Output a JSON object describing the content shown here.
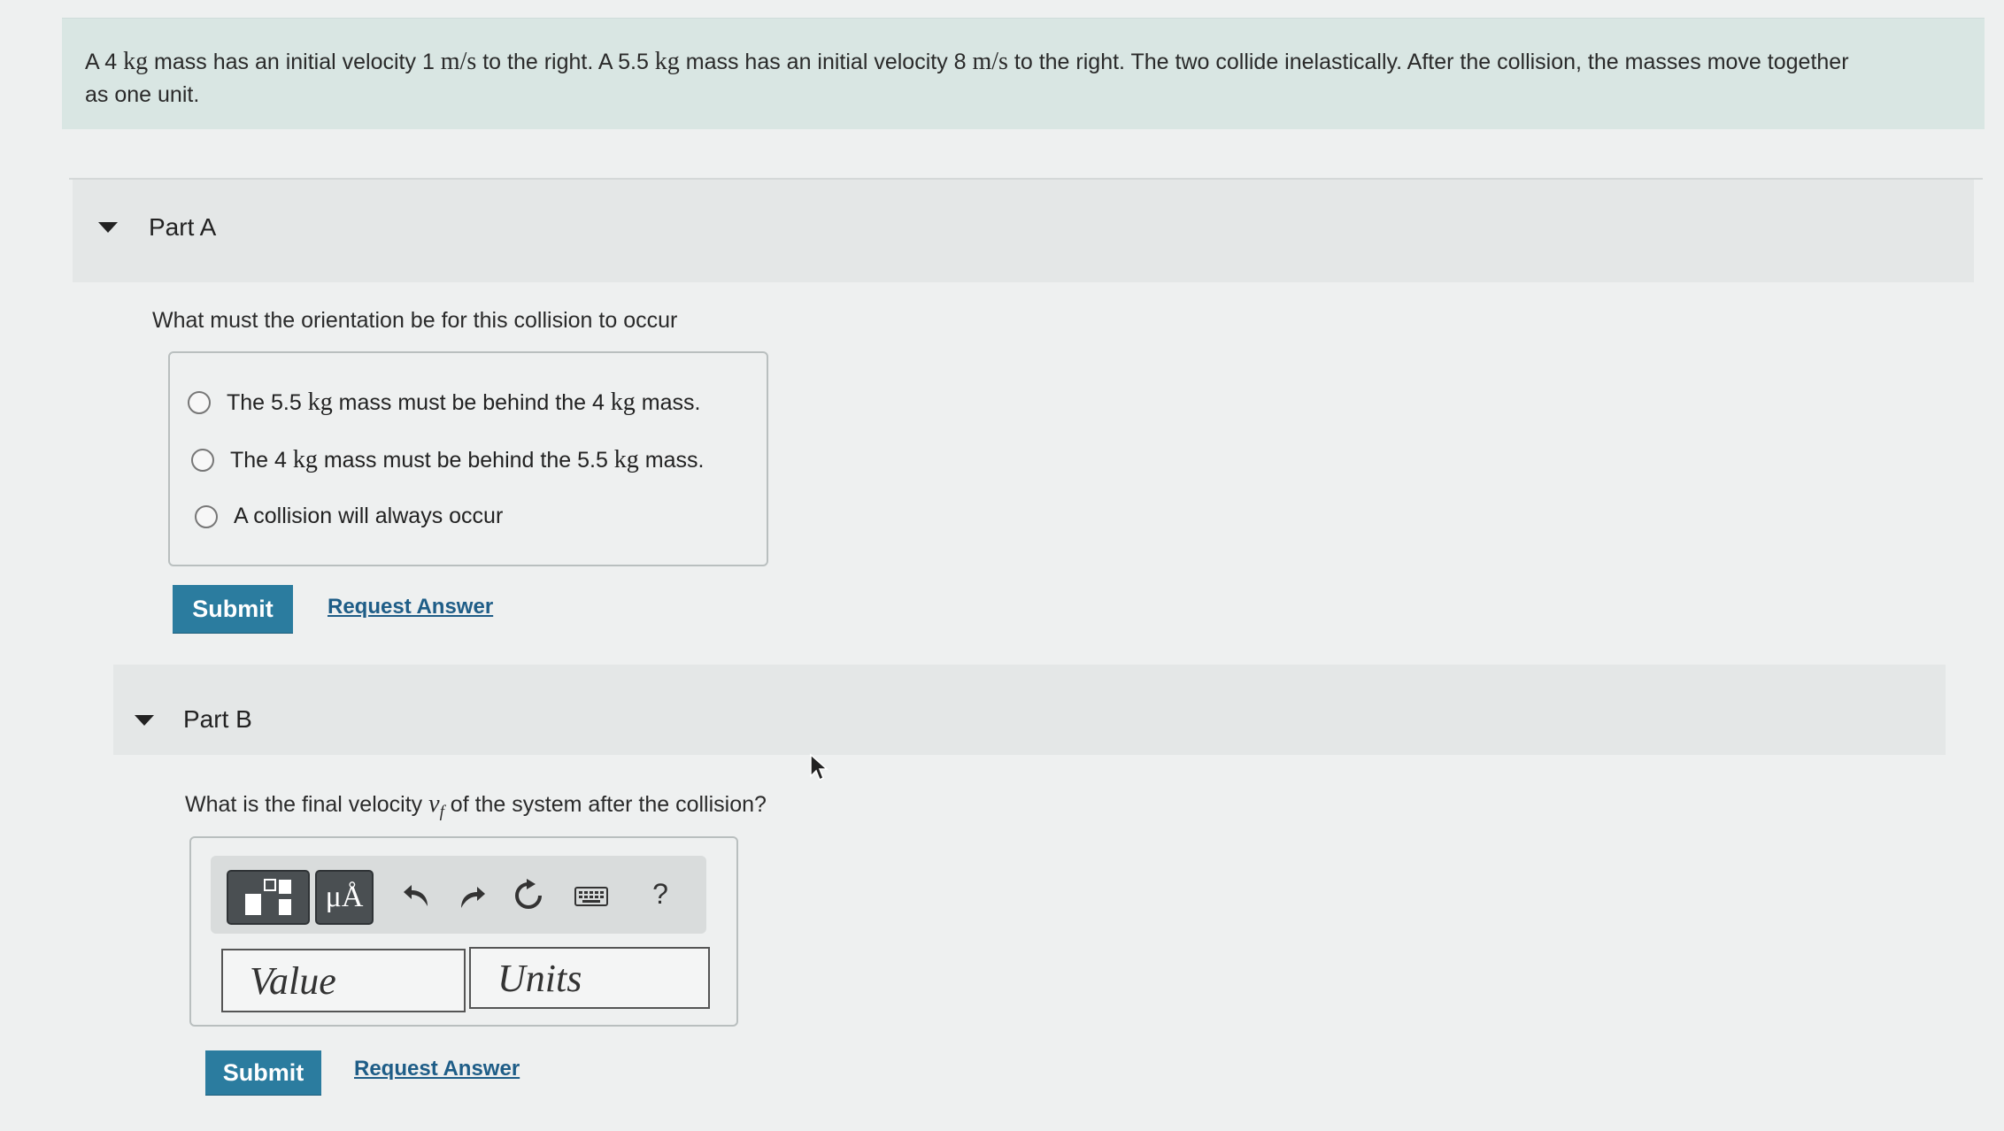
{
  "problem": {
    "seg1": "A 4 ",
    "u_kg1": "kg",
    "seg2": " mass has an initial velocity 1 ",
    "u_ms1": "m/s",
    "seg3": " to the right.  A 5.5 ",
    "u_kg2": "kg",
    "seg4": " mass has an initial velocity 8 ",
    "u_ms2": "m/s",
    "seg5": " to the right.  The two collide inelastically.  After the collision, the masses move together",
    "line2": "as one unit."
  },
  "part_a": {
    "label": "Part A",
    "question": "What must the orientation be for this collision to occur",
    "choices": [
      {
        "pre": "The 5.5 ",
        "unit1": "kg",
        "mid": " mass must be behind the 4 ",
        "unit2": "kg",
        "post": " mass."
      },
      {
        "pre": "The 4 ",
        "unit1": "kg",
        "mid": " mass must be behind the 5.5 ",
        "unit2": "kg",
        "post": " mass."
      },
      {
        "text": "A collision will always occur"
      }
    ],
    "submit_label": "Submit",
    "request_label": "Request Answer"
  },
  "part_b": {
    "label": "Part B",
    "question_pre": "What is the final velocity ",
    "var": "v",
    "sub": "f",
    "question_post": " of the system after the collision?",
    "toolbar": {
      "units_label": "μÅ",
      "help_label": "?"
    },
    "value_placeholder": "Value",
    "units_placeholder": "Units",
    "submit_label": "Submit",
    "request_label": "Request Answer"
  },
  "colors": {
    "submit_bg": "#2b7c9f",
    "link": "#1e5d87",
    "problem_bg": "#d9e6e3"
  }
}
